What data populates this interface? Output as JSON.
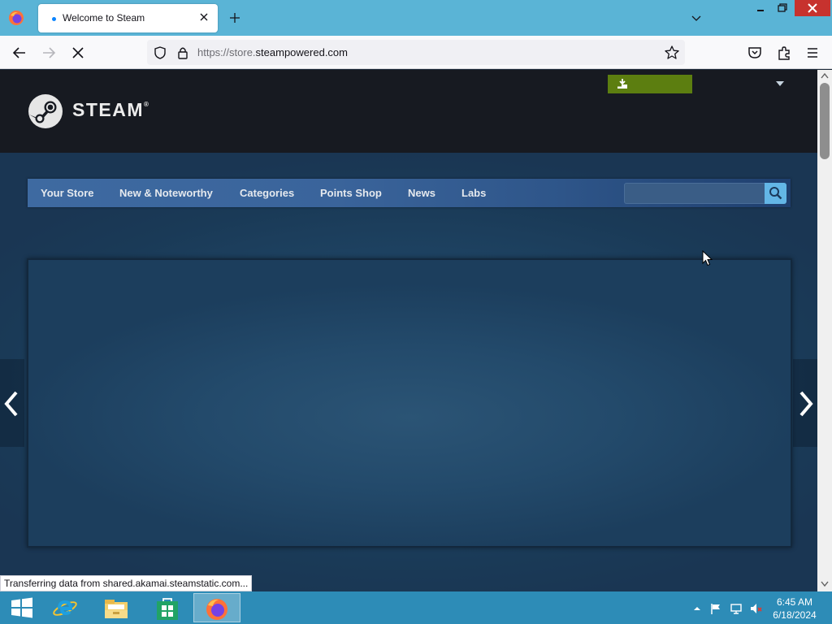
{
  "browser": {
    "tab_title": "Welcome to Steam",
    "url_prefix": "https://store.",
    "url_domain": "steampowered.com",
    "status_text": "Transferring data from shared.akamai.steamstatic.com..."
  },
  "steam": {
    "brand": "STEAM",
    "trademark": "®",
    "nav_tabs": [
      "Your Store",
      "New & Noteworthy",
      "Categories",
      "Points Shop",
      "News",
      "Labs"
    ],
    "install_button_color": "#5c7e10",
    "accent_color": "#66c0f4"
  },
  "taskbar": {
    "time": "6:45 AM",
    "date": "6/18/2024",
    "pinned": [
      "start-icon",
      "internet-explorer-icon",
      "file-explorer-icon",
      "store-icon",
      "firefox-icon"
    ]
  }
}
